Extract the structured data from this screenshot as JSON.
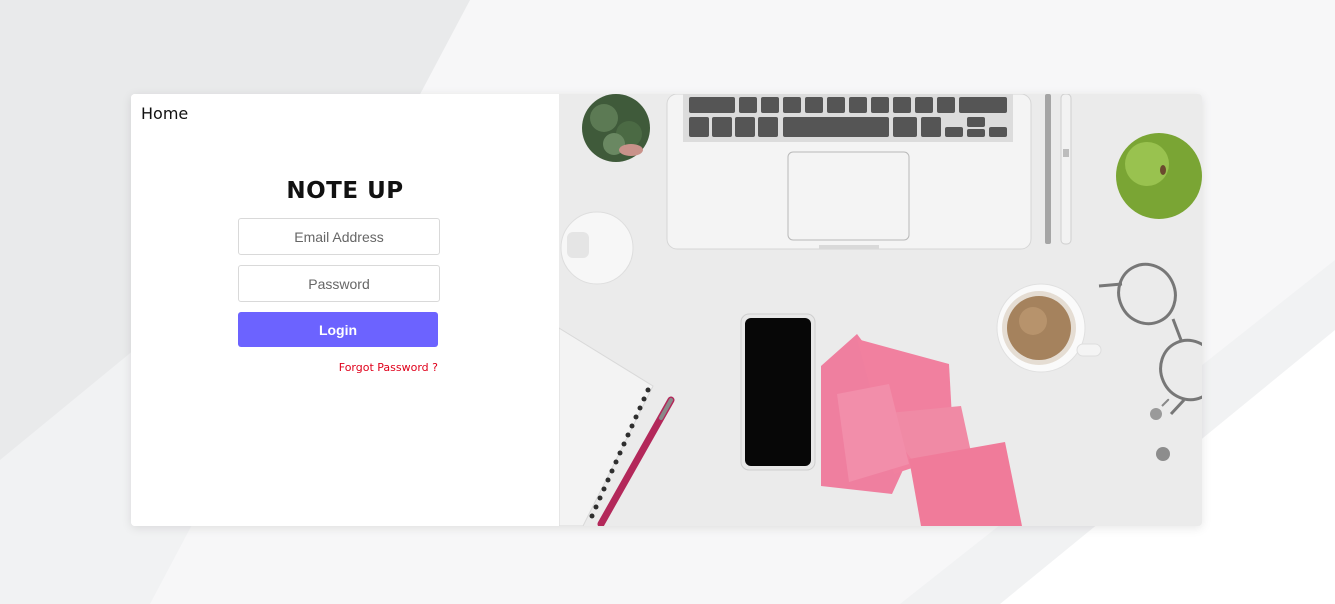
{
  "header": {
    "home_label": "Home"
  },
  "login": {
    "brand": "NOTE UP",
    "email_placeholder": "Email Address",
    "password_placeholder": "Password",
    "login_label": "Login",
    "forgot_label": "Forgot Password ?"
  },
  "hero_image": {
    "description_icon": "desk-workspace-photo"
  },
  "colors": {
    "accent": "#6c63ff",
    "link_red": "#e0001b",
    "page_background": "#f1f2f3"
  }
}
